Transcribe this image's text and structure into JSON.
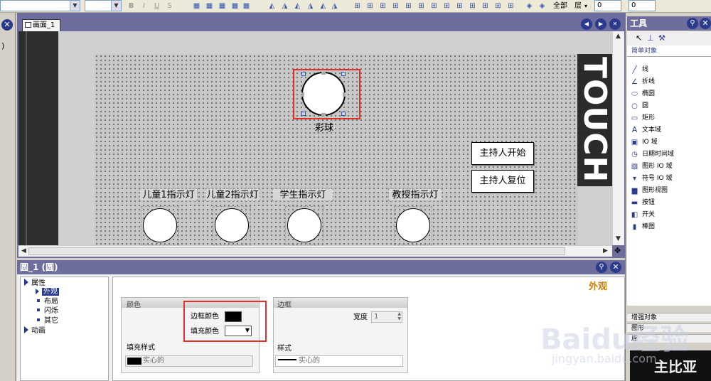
{
  "toolbar": {
    "layer_all": "全部",
    "layer_label": "层",
    "spin1": "0",
    "spin2": "0"
  },
  "editor": {
    "tab_label": "画面_1",
    "touch_text": "TOUCH",
    "ball_label": "彩球",
    "lamps": [
      {
        "label": "儿童1指示灯"
      },
      {
        "label": "儿童2指示灯"
      },
      {
        "label": "学生指示灯"
      },
      {
        "label": "教授指示灯"
      }
    ],
    "buttons": {
      "start": "主持人开始",
      "reset": "主持人复位"
    },
    "left_mark": ")"
  },
  "properties": {
    "title": "圆_1 (圆)",
    "section_title": "外观",
    "tree": [
      {
        "label": "属性",
        "level": 0
      },
      {
        "label": "外观",
        "level": 1,
        "selected": true
      },
      {
        "label": "布局",
        "level": 1
      },
      {
        "label": "闪烁",
        "level": 1
      },
      {
        "label": "其它",
        "level": 1
      },
      {
        "label": "动画",
        "level": 0
      }
    ],
    "color_group": {
      "title": "颜色",
      "border_color_label": "边框颜色",
      "fill_color_label": "填充颜色",
      "border_color": "#000000",
      "fill_color": "#ffffff"
    },
    "fill_style": {
      "label": "填充样式",
      "value": "实心的"
    },
    "border_group": {
      "title": "边框",
      "width_label": "宽度",
      "width_value": "1",
      "style_label": "样式",
      "style_value": "实心的"
    }
  },
  "tools": {
    "title": "工具",
    "category": "简单对象",
    "items": [
      {
        "label": "线",
        "icon": "line-icon"
      },
      {
        "label": "折线",
        "icon": "polyline-icon"
      },
      {
        "label": "椭圆",
        "icon": "ellipse-icon"
      },
      {
        "label": "圆",
        "icon": "circle-icon"
      },
      {
        "label": "矩形",
        "icon": "rectangle-icon"
      },
      {
        "label": "文本域",
        "icon": "text-icon"
      },
      {
        "label": "IO 域",
        "icon": "io-field-icon"
      },
      {
        "label": "日期时间域",
        "icon": "datetime-icon"
      },
      {
        "label": "图形 IO 域",
        "icon": "graphic-io-icon"
      },
      {
        "label": "符号 IO 域",
        "icon": "symbol-io-icon"
      },
      {
        "label": "图形视图",
        "icon": "graphic-view-icon"
      },
      {
        "label": "按钮",
        "icon": "button-icon"
      },
      {
        "label": "开关",
        "icon": "switch-icon"
      },
      {
        "label": "棒图",
        "icon": "bar-icon"
      }
    ],
    "bottom": [
      {
        "label": "增强对象"
      },
      {
        "label": "图形"
      },
      {
        "label": "库"
      }
    ],
    "image_text": "主比亚"
  },
  "watermark": {
    "logo": "Baidu经验",
    "url": "jingyan.baidu.com"
  }
}
